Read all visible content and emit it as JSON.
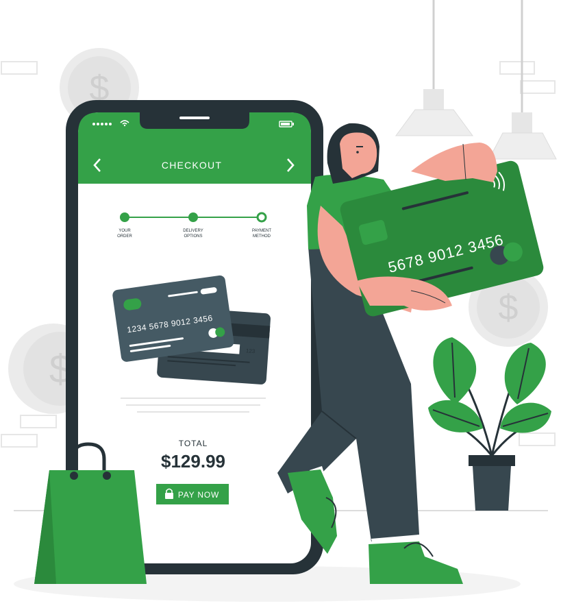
{
  "phone": {
    "status": {
      "signal_icon": "signal-dots-icon",
      "wifi_icon": "wifi-icon",
      "battery_icon": "battery-icon"
    },
    "header": {
      "title": "CHECKOUT",
      "back_icon": "chevron-left-icon",
      "forward_icon": "chevron-right-icon",
      "color": "#34A148"
    },
    "steps": [
      {
        "line1": "YOUR",
        "line2": "ORDER",
        "state": "done"
      },
      {
        "line1": "DELIVERY",
        "line2": "OPTIONS",
        "state": "done"
      },
      {
        "line1": "PAYMENT",
        "line2": "METHOD",
        "state": "current"
      }
    ],
    "card_front": {
      "number": "1234 5678 9012 3456"
    },
    "card_back": {
      "cvv": "123"
    },
    "total": {
      "label": "TOTAL",
      "amount": "$129.99"
    },
    "pay_button": {
      "label": "PAY NOW",
      "icon": "lock-icon"
    }
  },
  "person_card": {
    "number": "5678 9012 3456",
    "contactless_icon": "contactless-icon"
  },
  "decor": {
    "coin_icon": "dollar-coin-icon",
    "plant_icon": "potted-plant-icon",
    "bag_icon": "shopping-bag-icon",
    "lamp_icon": "pendant-lamp-icon"
  },
  "colors": {
    "accent": "#34A148",
    "dark": "#263238",
    "skin": "#F3A596",
    "grey": "#E0E0E0"
  }
}
